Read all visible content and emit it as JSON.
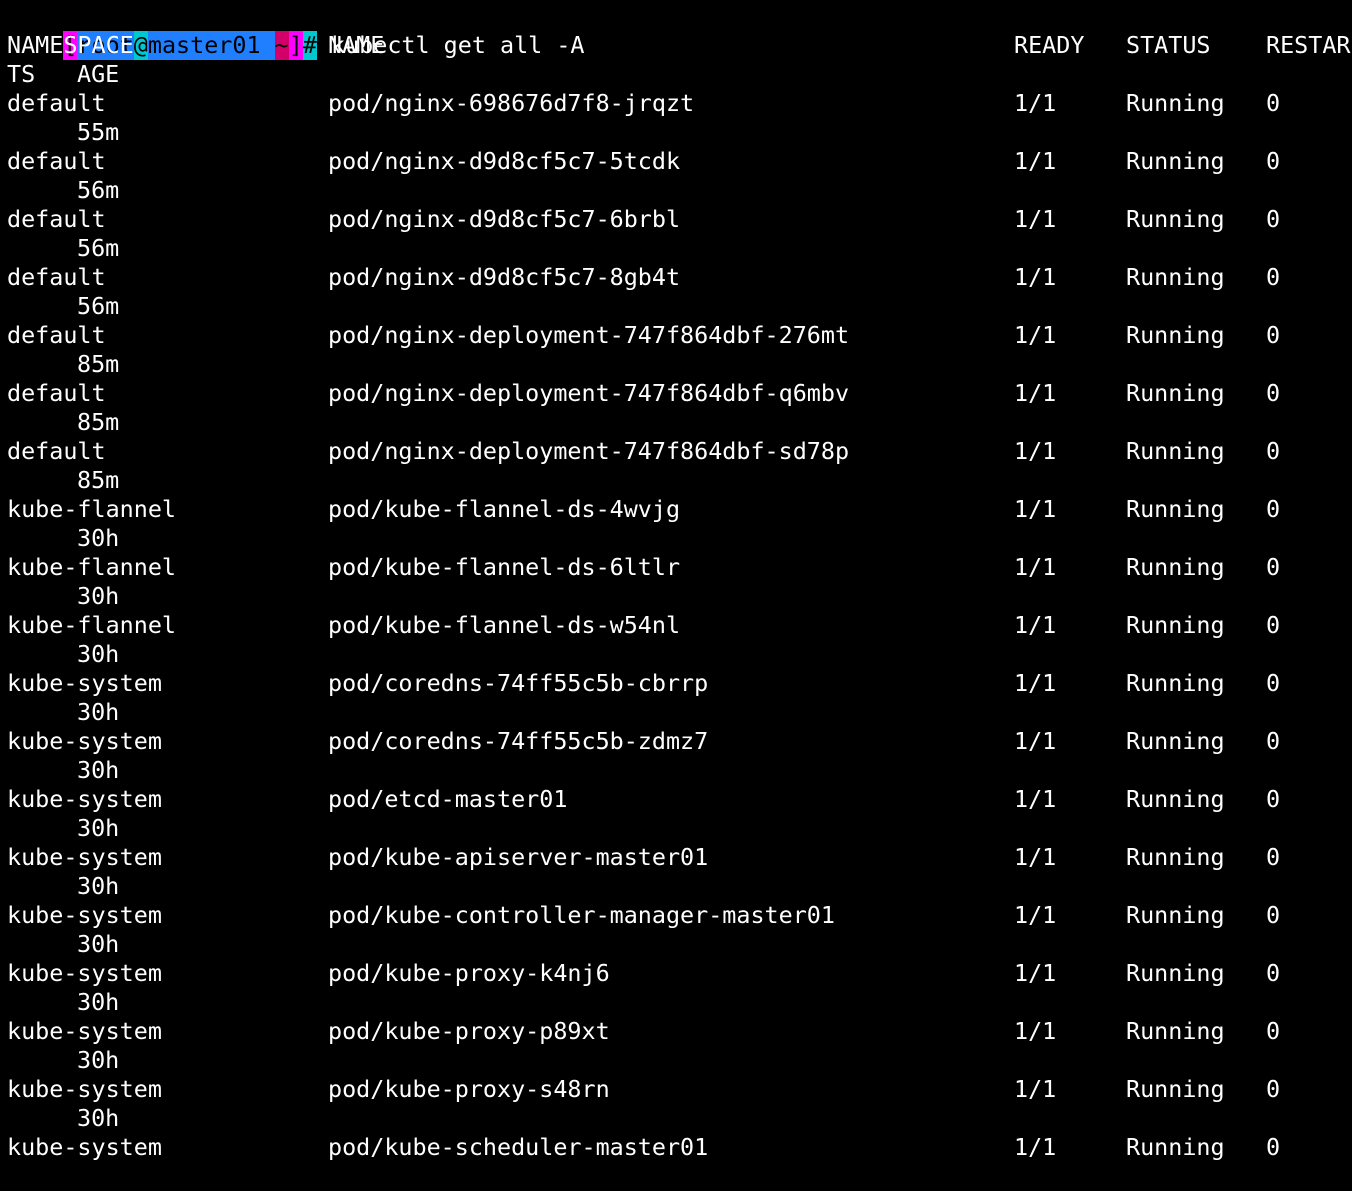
{
  "prompt": {
    "open_bracket": "[",
    "user": "root",
    "at": "@",
    "host": "master01",
    "space": " ",
    "cwd": "~",
    "close_bracket": "]",
    "hash": "#",
    "command": " kubectl get all -A"
  },
  "header": {
    "line1": {
      "namespace": "NAMESPACE",
      "name": "NAME",
      "ready": "READY",
      "status": "STATUS",
      "restarts_part": "RESTAR"
    },
    "line2": {
      "restarts_rest": "TS",
      "age": "AGE"
    }
  },
  "rows": [
    {
      "namespace": "default",
      "name": "pod/nginx-698676d7f8-jrqzt",
      "ready": "1/1",
      "status": "Running",
      "restarts": "0",
      "age": "55m"
    },
    {
      "namespace": "default",
      "name": "pod/nginx-d9d8cf5c7-5tcdk",
      "ready": "1/1",
      "status": "Running",
      "restarts": "0",
      "age": "56m"
    },
    {
      "namespace": "default",
      "name": "pod/nginx-d9d8cf5c7-6brbl",
      "ready": "1/1",
      "status": "Running",
      "restarts": "0",
      "age": "56m"
    },
    {
      "namespace": "default",
      "name": "pod/nginx-d9d8cf5c7-8gb4t",
      "ready": "1/1",
      "status": "Running",
      "restarts": "0",
      "age": "56m"
    },
    {
      "namespace": "default",
      "name": "pod/nginx-deployment-747f864dbf-276mt",
      "ready": "1/1",
      "status": "Running",
      "restarts": "0",
      "age": "85m"
    },
    {
      "namespace": "default",
      "name": "pod/nginx-deployment-747f864dbf-q6mbv",
      "ready": "1/1",
      "status": "Running",
      "restarts": "0",
      "age": "85m"
    },
    {
      "namespace": "default",
      "name": "pod/nginx-deployment-747f864dbf-sd78p",
      "ready": "1/1",
      "status": "Running",
      "restarts": "0",
      "age": "85m"
    },
    {
      "namespace": "kube-flannel",
      "name": "pod/kube-flannel-ds-4wvjg",
      "ready": "1/1",
      "status": "Running",
      "restarts": "0",
      "age": "30h"
    },
    {
      "namespace": "kube-flannel",
      "name": "pod/kube-flannel-ds-6ltlr",
      "ready": "1/1",
      "status": "Running",
      "restarts": "0",
      "age": "30h"
    },
    {
      "namespace": "kube-flannel",
      "name": "pod/kube-flannel-ds-w54nl",
      "ready": "1/1",
      "status": "Running",
      "restarts": "0",
      "age": "30h"
    },
    {
      "namespace": "kube-system",
      "name": "pod/coredns-74ff55c5b-cbrrp",
      "ready": "1/1",
      "status": "Running",
      "restarts": "0",
      "age": "30h"
    },
    {
      "namespace": "kube-system",
      "name": "pod/coredns-74ff55c5b-zdmz7",
      "ready": "1/1",
      "status": "Running",
      "restarts": "0",
      "age": "30h"
    },
    {
      "namespace": "kube-system",
      "name": "pod/etcd-master01",
      "ready": "1/1",
      "status": "Running",
      "restarts": "0",
      "age": "30h"
    },
    {
      "namespace": "kube-system",
      "name": "pod/kube-apiserver-master01",
      "ready": "1/1",
      "status": "Running",
      "restarts": "0",
      "age": "30h"
    },
    {
      "namespace": "kube-system",
      "name": "pod/kube-controller-manager-master01",
      "ready": "1/1",
      "status": "Running",
      "restarts": "0",
      "age": "30h"
    },
    {
      "namespace": "kube-system",
      "name": "pod/kube-proxy-k4nj6",
      "ready": "1/1",
      "status": "Running",
      "restarts": "0",
      "age": "30h"
    },
    {
      "namespace": "kube-system",
      "name": "pod/kube-proxy-p89xt",
      "ready": "1/1",
      "status": "Running",
      "restarts": "0",
      "age": "30h"
    },
    {
      "namespace": "kube-system",
      "name": "pod/kube-proxy-s48rn",
      "ready": "1/1",
      "status": "Running",
      "restarts": "0",
      "age": "30h"
    },
    {
      "namespace": "kube-system",
      "name": "pod/kube-scheduler-master01",
      "ready": "1/1",
      "status": "Running",
      "restarts": "0",
      "age": ""
    }
  ]
}
